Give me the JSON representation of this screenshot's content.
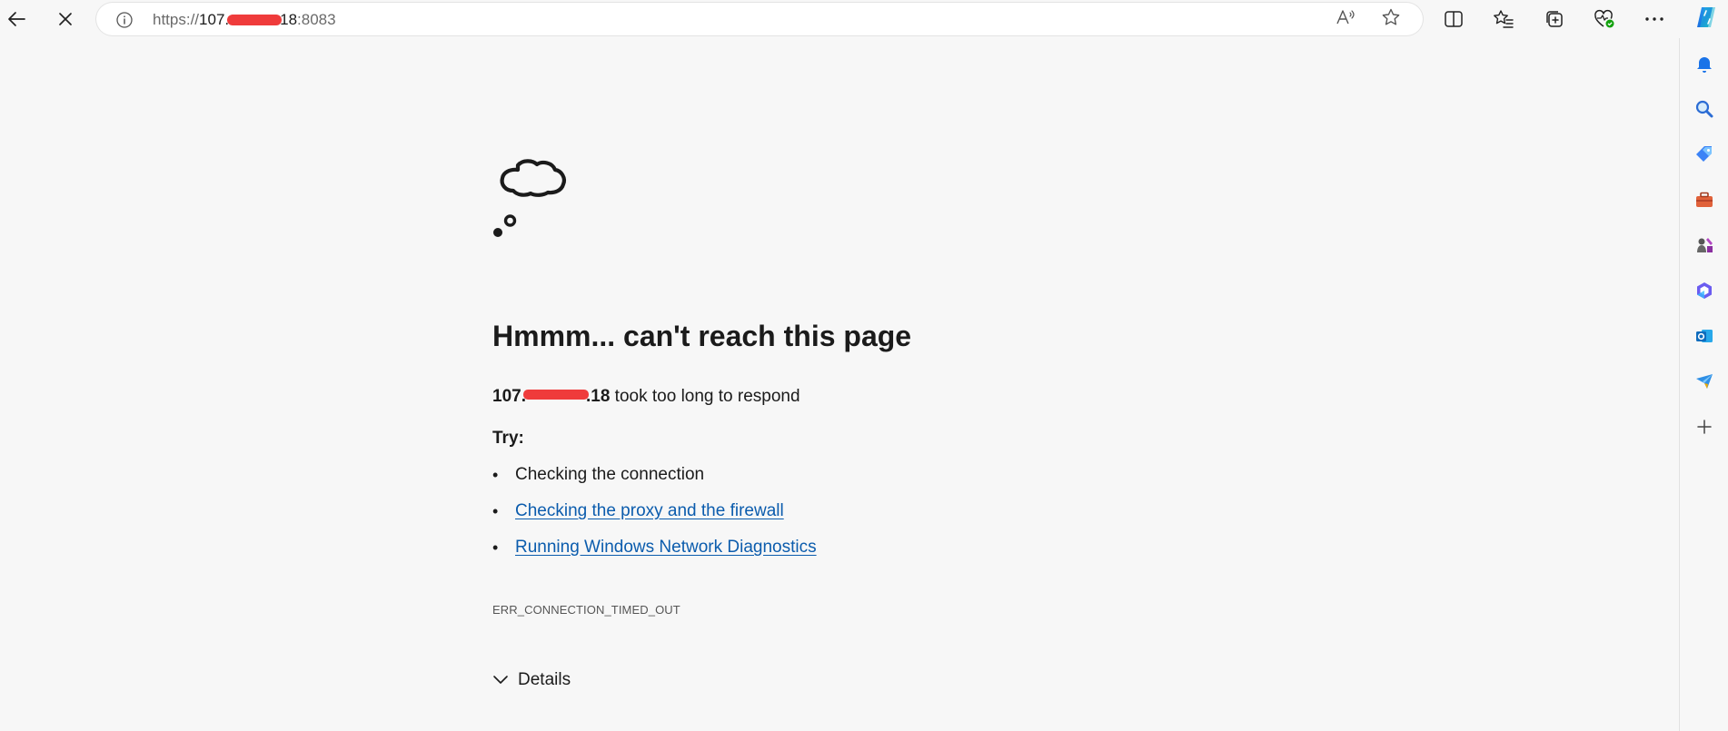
{
  "browser": {
    "address_bar": {
      "url_scheme": "https://",
      "url_host_start": "107.",
      "url_host_end": "18",
      "url_port": ":8083"
    },
    "toolbar_icons": [
      "back-icon",
      "stop-icon",
      "info-icon",
      "read-aloud-icon",
      "favorite-star-icon",
      "split-screen-icon",
      "favorites-icon",
      "collections-icon",
      "browser-essentials-icon",
      "more-icon",
      "copilot-icon"
    ],
    "sidebar_icons": [
      "notifications-icon",
      "search-icon",
      "shopping-tag-icon",
      "tools-icon",
      "games-icon",
      "microsoft-365-icon",
      "outlook-icon",
      "drop-icon",
      "add-icon"
    ]
  },
  "error_page": {
    "title": "Hmmm... can't reach this page",
    "host_start": "107.",
    "host_end": ".18",
    "subtitle_suffix": " took too long to respond",
    "try_label": "Try:",
    "tips": [
      {
        "text": "Checking the connection",
        "link": false
      },
      {
        "text": "Checking the proxy and the firewall",
        "link": true
      },
      {
        "text": "Running Windows Network Diagnostics",
        "link": true
      }
    ],
    "error_code": "ERR_CONNECTION_TIMED_OUT",
    "details_label": "Details"
  },
  "colors": {
    "background": "#f7f7f7",
    "link": "#0b5cad",
    "redaction": "#ef3b3b",
    "text": "#1b1b1b"
  }
}
